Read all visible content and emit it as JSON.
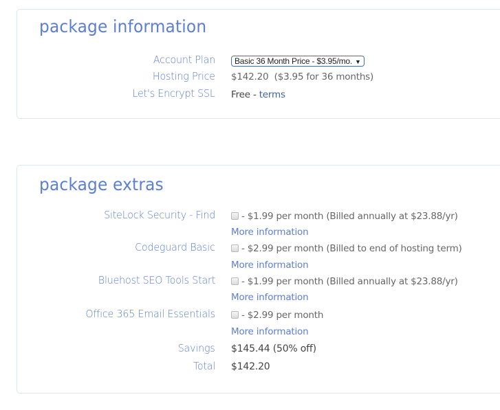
{
  "package_information": {
    "title": "package information",
    "account_plan": {
      "label": "Account Plan",
      "selected": "Basic 36 Month Price - $3.95/mo."
    },
    "hosting_price": {
      "label": "Hosting Price",
      "value": "$142.20",
      "detail": "($3.95 for 36 months)"
    },
    "ssl": {
      "label": "Let's Encrypt SSL",
      "value": "Free - ",
      "link": "terms"
    }
  },
  "package_extras": {
    "title": "package extras",
    "items": [
      {
        "label": "SiteLock Security - Find",
        "checked": false,
        "price_text": "- $1.99 per month (Billed annually at $23.88/yr)",
        "more": "More information"
      },
      {
        "label": "Codeguard Basic",
        "checked": false,
        "price_text": "- $2.99 per month (Billed to end of hosting term)",
        "more": "More information"
      },
      {
        "label": "Bluehost SEO Tools Start",
        "checked": false,
        "price_text": "- $1.99 per month (Billed annually at $23.88/yr)",
        "more": "More information"
      },
      {
        "label": "Office 365 Email Essentials",
        "checked": false,
        "price_text": "- $2.99 per month",
        "more": "More information"
      }
    ],
    "savings": {
      "label": "Savings",
      "value": "$145.44 (50% off)"
    },
    "total": {
      "label": "Total",
      "value": "$142.20"
    }
  }
}
